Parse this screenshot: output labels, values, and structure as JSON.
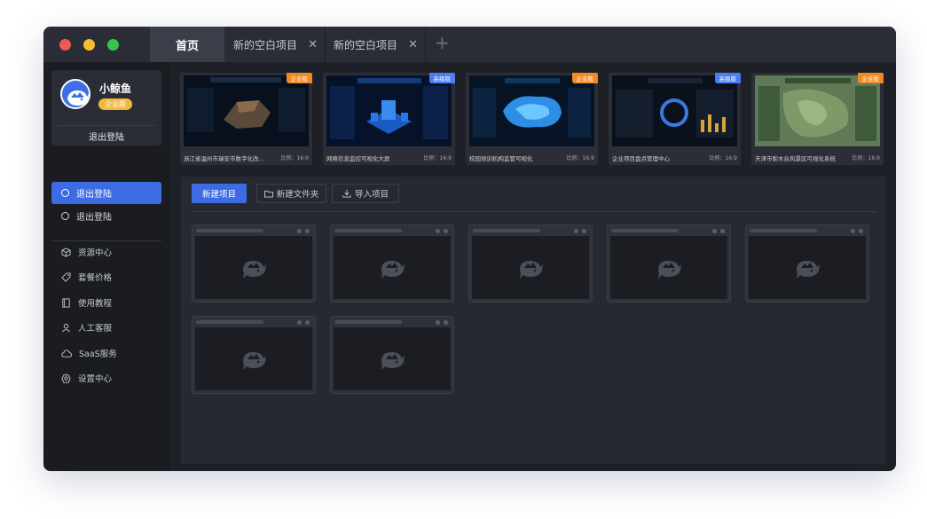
{
  "titlebar": {
    "tabs": [
      {
        "label": "首页"
      },
      {
        "label": "新的空白项目"
      },
      {
        "label": "新的空白项目"
      }
    ],
    "close_glyph": "✕",
    "add_glyph": "+"
  },
  "sidebar": {
    "user": {
      "name": "小鲸鱼",
      "badge": "企业版",
      "action": "退出登陆"
    },
    "nav": [
      {
        "label": "退出登陆",
        "active": true
      },
      {
        "label": "退出登陆",
        "active": false
      }
    ],
    "menu": [
      {
        "label": "资源中心",
        "icon": "cube-icon"
      },
      {
        "label": "套餐价格",
        "icon": "tag-icon"
      },
      {
        "label": "使用教程",
        "icon": "book-icon"
      },
      {
        "label": "人工客服",
        "icon": "user-icon"
      },
      {
        "label": "SaaS服务",
        "icon": "cloud-icon"
      },
      {
        "label": "设置中心",
        "icon": "gear-icon"
      }
    ]
  },
  "templates": [
    {
      "name": "浙江省温州市瑞安市数字化改...",
      "ratio": "比例：16:9",
      "tier": "企业版"
    },
    {
      "name": "网络信息监控可视化大屏",
      "ratio": "比例：16:9",
      "tier": "高级版"
    },
    {
      "name": "校园培训机构监管可视化",
      "ratio": "比例：16:9",
      "tier": "企业版"
    },
    {
      "name": "企业项目盘点管理中心",
      "ratio": "比例：16:9",
      "tier": "高级版"
    },
    {
      "name": "天津市梨木台风景区可视化系统",
      "ratio": "比例：16:9",
      "tier": "企业版"
    }
  ],
  "toolbar": {
    "new_project": "新建项目",
    "new_folder": "新建文件夹",
    "import_project": "导入项目"
  },
  "projects_count": 7,
  "colors": {
    "accent": "#3d6be4",
    "enterprise_ribbon": "#f08a24",
    "advanced_ribbon": "#4a7df0",
    "badge": "#f3b938"
  }
}
